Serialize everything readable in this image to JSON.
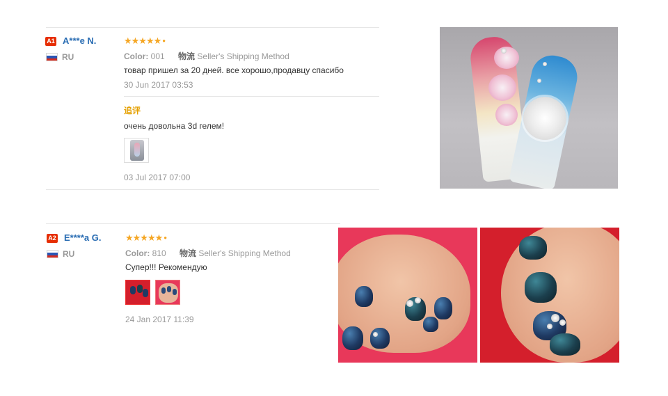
{
  "reviews": [
    {
      "badge": "A1",
      "name": "A***e N.",
      "country": "RU",
      "stars": "★★★★★",
      "color_label": "Color:",
      "color_value": "001",
      "shipping_cn": "物流",
      "shipping_method": "Seller's Shipping Method",
      "text": "товар пришел за 20 дней. все хорошо,продавцу спасибо",
      "date": "30 Jun 2017 03:53",
      "additional": {
        "label": "追评",
        "text": "очень довольна 3d гелем!",
        "date": "03 Jul 2017 07:00"
      }
    },
    {
      "badge": "A2",
      "name": "E****a G.",
      "country": "RU",
      "stars": "★★★★★",
      "color_label": "Color:",
      "color_value": "810",
      "shipping_cn": "物流",
      "shipping_method": "Seller's Shipping Method",
      "text": "Супер!!! Рекомендую",
      "date": "24 Jan 2017 11:39"
    }
  ],
  "colors": {
    "star": "#f5a623",
    "badge": "#e62e04",
    "name": "#2a6db3",
    "followup": "#e5a000"
  }
}
